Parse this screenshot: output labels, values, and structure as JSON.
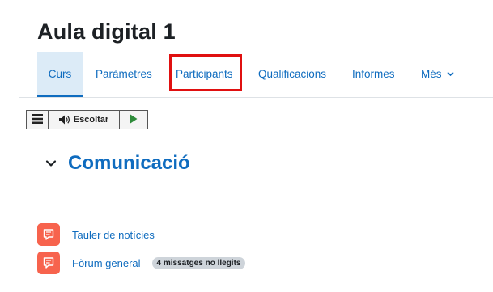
{
  "course": {
    "title": "Aula digital 1"
  },
  "nav": {
    "tabs": [
      {
        "label": "Curs",
        "active": true
      },
      {
        "label": "Paràmetres"
      },
      {
        "label": "Participants",
        "highlighted": true
      },
      {
        "label": "Qualificacions"
      },
      {
        "label": "Informes"
      },
      {
        "label": "Més"
      }
    ]
  },
  "toolbar": {
    "listen_label": "Escoltar",
    "icons": [
      "menu-icon",
      "speaker-icon",
      "play-icon"
    ]
  },
  "section": {
    "title": "Comunicació",
    "expanded": true
  },
  "activities": [
    {
      "name": "Tauler de notícies",
      "icon": "forum-icon"
    },
    {
      "name": "Fòrum general",
      "icon": "forum-icon",
      "badge": "4 missatges no llegits"
    }
  ],
  "colors": {
    "link": "#0f6cbf",
    "active_tab_bg": "#dcebf7",
    "forum_icon": "#f7634d",
    "highlight": "#e01010",
    "badge_bg": "#ced4da"
  }
}
